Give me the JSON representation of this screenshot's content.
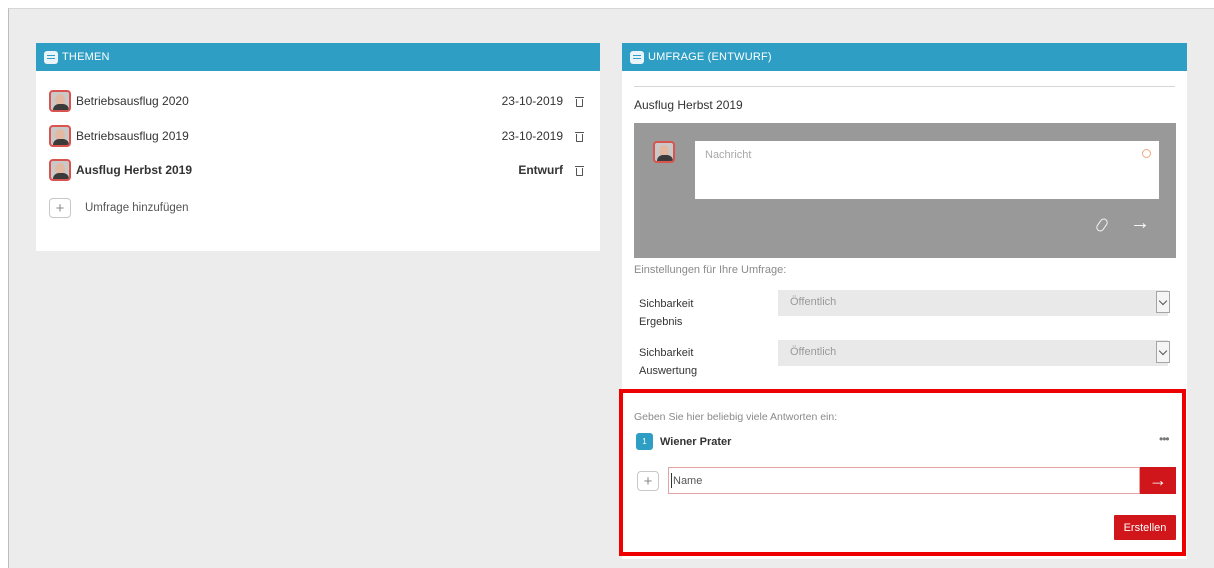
{
  "topics_panel": {
    "header_title": "THEMEN",
    "topics": [
      {
        "title": "Betriebsausflug 2020",
        "meta": "23-10-2019",
        "bold": false
      },
      {
        "title": "Betriebsausflug 2019",
        "meta": "23-10-2019",
        "bold": false
      },
      {
        "title": "Ausflug Herbst 2019",
        "meta": "Entwurf",
        "bold": true
      }
    ],
    "add_survey_label": "Umfrage hinzufügen"
  },
  "survey_panel": {
    "header_title": "UMFRAGE (ENTWURF)",
    "survey_title": "Ausflug Herbst 2019",
    "message_placeholder": "Nachricht",
    "settings_label": "Einstellungen für Ihre Umfrage:",
    "settings": [
      {
        "label": "Sichbarkeit Ergebnis",
        "value": "Öffentlich"
      },
      {
        "label": "Sichbarkeit Auswertung",
        "value": "Öffentlich"
      }
    ],
    "answers_label": "Geben Sie hier beliebig viele Antworten ein:",
    "answers": [
      {
        "number": "1",
        "text": "Wiener Prater"
      }
    ],
    "more_label": "•••",
    "name_placeholder": "Name",
    "create_button": "Erstellen"
  },
  "colors": {
    "header_blue": "#2f9ec4",
    "action_red": "#d0161b",
    "highlight_red": "#ee0000"
  },
  "icons": {
    "header": "speech-bubble-icon",
    "delete": "trash-icon",
    "add": "plus-icon",
    "attach": "paperclip-icon",
    "send": "arrow-right-icon",
    "emoji": "smiley-icon",
    "more": "more-dots-icon"
  }
}
